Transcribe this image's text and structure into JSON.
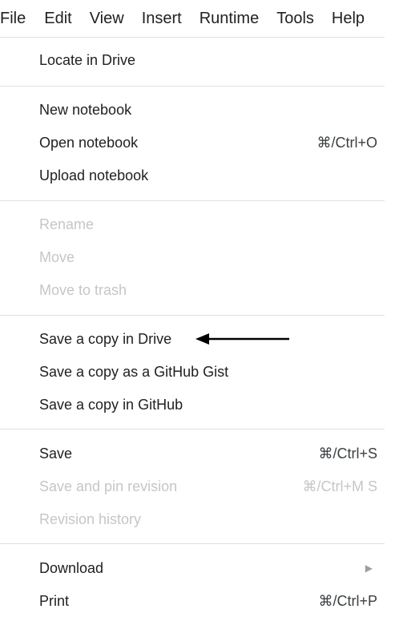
{
  "menubar": {
    "items": [
      "File",
      "Edit",
      "View",
      "Insert",
      "Runtime",
      "Tools",
      "Help"
    ],
    "active": "File"
  },
  "file_menu": {
    "locate": "Locate in Drive",
    "new_notebook": "New notebook",
    "open_notebook": "Open notebook",
    "open_shortcut": "⌘/Ctrl+O",
    "upload_notebook": "Upload notebook",
    "rename": "Rename",
    "move": "Move",
    "move_to_trash": "Move to trash",
    "save_copy_drive": "Save a copy in Drive",
    "save_copy_gist": "Save a copy as a GitHub Gist",
    "save_copy_github": "Save a copy in GitHub",
    "save": "Save",
    "save_shortcut": "⌘/Ctrl+S",
    "save_pin": "Save and pin revision",
    "save_pin_shortcut": "⌘/Ctrl+M S",
    "revision_history": "Revision history",
    "download": "Download",
    "download_arrow": "▶",
    "print": "Print",
    "print_shortcut": "⌘/Ctrl+P"
  },
  "colors": {
    "text": "#212121",
    "disabled_text": "#c6c6c6",
    "divider": "#e0e0e0",
    "annotation_arrow": "#000000"
  },
  "annotation": {
    "arrow_icon": "left-arrow-icon",
    "points_to": "Save a copy in Drive"
  }
}
